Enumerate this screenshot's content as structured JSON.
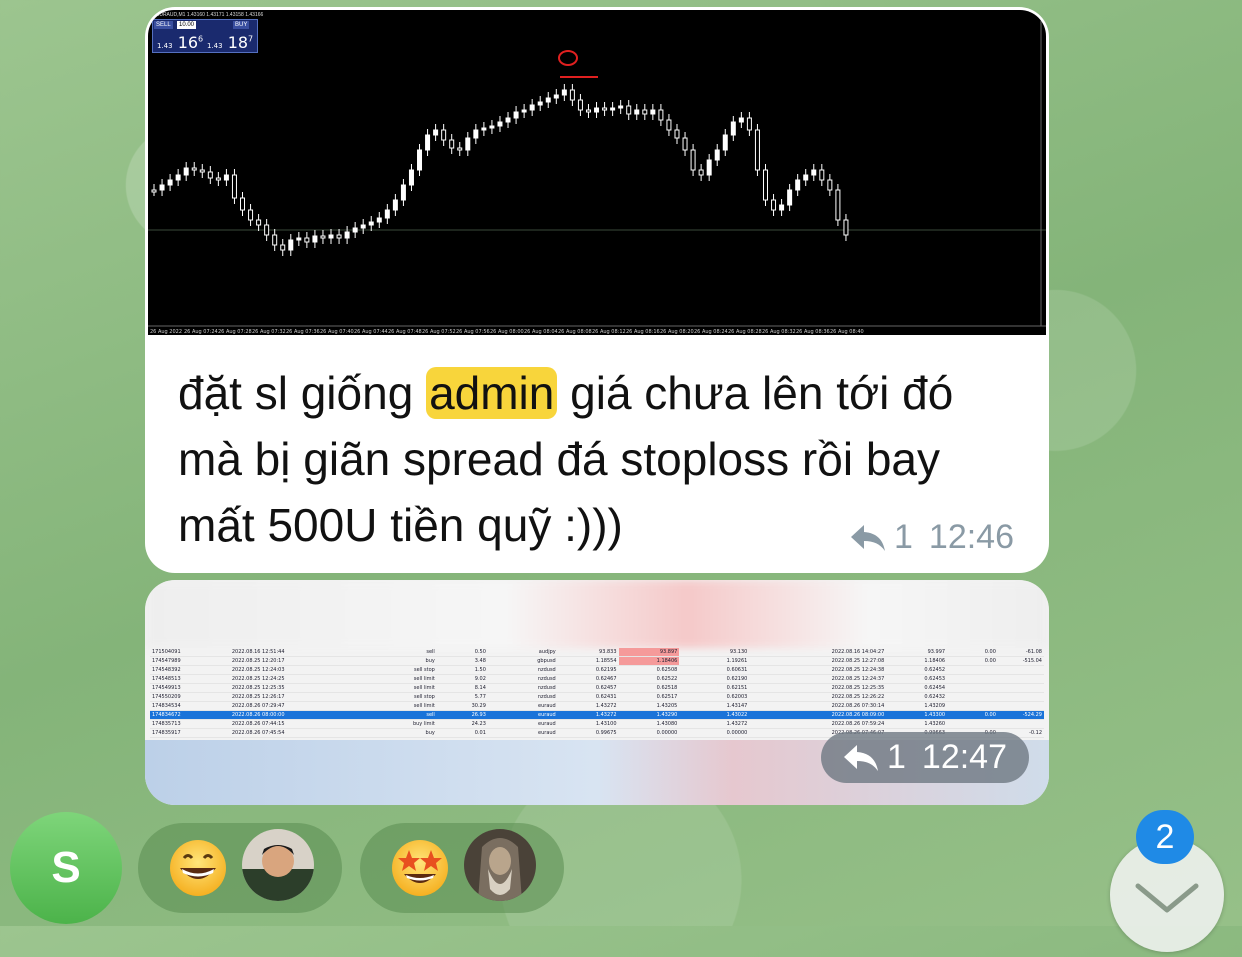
{
  "message1": {
    "chart_image": {
      "ohlc_label": "EURAUD,M1  1.43160 1.43171 1.43158 1.43166",
      "trade_panel": {
        "sell_label": "SELL",
        "lot_value": "10.00",
        "buy_label": "BUY",
        "sell_price": {
          "prefix": "1.43",
          "big": "16",
          "sup": "6"
        },
        "buy_price": {
          "prefix": "1.43",
          "big": "18",
          "sup": "7"
        }
      },
      "time_axis": [
        "26 Aug 2022",
        "26 Aug 07:24",
        "26 Aug 07:28",
        "26 Aug 07:32",
        "26 Aug 07:36",
        "26 Aug 07:40",
        "26 Aug 07:44",
        "26 Aug 07:48",
        "26 Aug 07:52",
        "26 Aug 07:56",
        "26 Aug 08:00",
        "26 Aug 08:04",
        "26 Aug 08:08",
        "26 Aug 08:12",
        "26 Aug 08:16",
        "26 Aug 08:20",
        "26 Aug 08:24",
        "26 Aug 08:28",
        "26 Aug 08:32",
        "26 Aug 08:36",
        "26 Aug 08:40"
      ],
      "annotation_color": "#e02020",
      "candle_color": "#ffffff",
      "grid_color": "#3a4a3a"
    },
    "text_before": "đặt sl giống ",
    "text_highlight": "admin",
    "text_after": " giá chưa lên tới đó mà bị giãn spread đá stoploss rồi bay mất 500U tiền quỹ :)))",
    "reply_count": "1",
    "time": "12:46",
    "highlight_color": "#f8d53b"
  },
  "message2": {
    "table_rows": [
      {
        "id": "171504091",
        "opened": "2022.08.16 12:51:44",
        "type": "sell",
        "vol": "0.50",
        "sym": "audjpy",
        "p1": "93.833",
        "p2": "93.897",
        "p3": "93.130",
        "closed": "2022.08.16 14:04:27",
        "p4": "93.997",
        "sw": "0.00",
        "pl": "-61.08",
        "selected": false
      },
      {
        "id": "174547989",
        "opened": "2022.08.25 12:20:17",
        "type": "buy",
        "vol": "3.48",
        "sym": "gbpusd",
        "p1": "1.18554",
        "p2": "1.18406",
        "p3": "1.19261",
        "closed": "2022.08.25 12:27:08",
        "p4": "1.18406",
        "sw": "0.00",
        "pl": "-515.04",
        "selected": false
      },
      {
        "id": "174548392",
        "opened": "2022.08.25 12:24:03",
        "type": "sell stop",
        "vol": "1.50",
        "sym": "nzdusd",
        "p1": "0.62195",
        "p2": "0.62508",
        "p3": "0.60631",
        "closed": "2022.08.25 12:24:38",
        "p4": "0.62452",
        "sw": "",
        "pl": "",
        "selected": false
      },
      {
        "id": "174548513",
        "opened": "2022.08.25 12:24:25",
        "type": "sell limit",
        "vol": "9.02",
        "sym": "nzdusd",
        "p1": "0.62467",
        "p2": "0.62522",
        "p3": "0.62190",
        "closed": "2022.08.25 12:24:37",
        "p4": "0.62453",
        "sw": "",
        "pl": "",
        "selected": false
      },
      {
        "id": "174549913",
        "opened": "2022.08.25 12:25:35",
        "type": "sell limit",
        "vol": "8.14",
        "sym": "nzdusd",
        "p1": "0.62457",
        "p2": "0.62518",
        "p3": "0.62151",
        "closed": "2022.08.25 12:25:35",
        "p4": "0.62454",
        "sw": "",
        "pl": "",
        "selected": false
      },
      {
        "id": "174550209",
        "opened": "2022.08.25 12:26:17",
        "type": "sell stop",
        "vol": "5.77",
        "sym": "nzdusd",
        "p1": "0.62431",
        "p2": "0.62517",
        "p3": "0.62003",
        "closed": "2022.08.25 12:26:22",
        "p4": "0.62432",
        "sw": "",
        "pl": "",
        "selected": false
      },
      {
        "id": "174834534",
        "opened": "2022.08.26 07:29:47",
        "type": "sell limit",
        "vol": "30.29",
        "sym": "euraud",
        "p1": "1.43272",
        "p2": "1.43205",
        "p3": "1.43147",
        "closed": "2022.08.26 07:30:14",
        "p4": "1.43209",
        "sw": "",
        "pl": "",
        "selected": false
      },
      {
        "id": "174834672",
        "opened": "2022.08.26 08:00:00",
        "type": "sell",
        "vol": "26.93",
        "sym": "euraud",
        "p1": "1.43272",
        "p2": "1.43290",
        "p3": "1.43022",
        "closed": "2022.08.26 08:09:00",
        "p4": "1.43300",
        "sw": "0.00",
        "pl": "-524.29",
        "selected": true
      },
      {
        "id": "174835713",
        "opened": "2022.08.26 07:44:15",
        "type": "buy limit",
        "vol": "24.23",
        "sym": "euraud",
        "p1": "1.43100",
        "p2": "1.43080",
        "p3": "1.43272",
        "closed": "2022.08.26 07:59:24",
        "p4": "1.43260",
        "sw": "",
        "pl": "",
        "selected": false
      },
      {
        "id": "174835917",
        "opened": "2022.08.26 07:45:54",
        "type": "buy",
        "vol": "0.01",
        "sym": "euraud",
        "p1": "0.99675",
        "p2": "0.00000",
        "p3": "0.00000",
        "closed": "2022.08.26 07:46:07",
        "p4": "0.99663",
        "sw": "0.00",
        "pl": "-0.12",
        "selected": false
      }
    ],
    "reply_count": "1",
    "time": "12:47"
  },
  "sender_avatar": {
    "letter": "S",
    "color": "#5cc05a"
  },
  "reactions": [
    {
      "emoji_name": "grinning-face",
      "count_avatar": "user-photo-man"
    },
    {
      "emoji_name": "star-struck-face",
      "count_avatar": "user-photo-portrait"
    }
  ],
  "scroll_button": {
    "unread_count": "2",
    "badge_color": "#1f8ae6"
  }
}
